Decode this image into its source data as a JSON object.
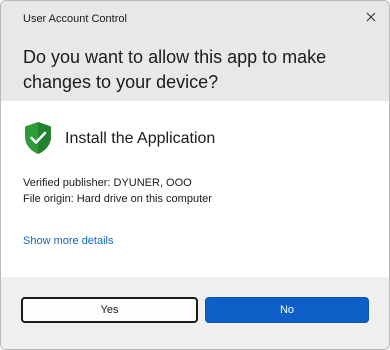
{
  "window": {
    "title": "User Account Control"
  },
  "header": {
    "question": "Do you want to allow this app to make changes to your device?"
  },
  "app": {
    "name": "Install the Application",
    "publisher": "Verified publisher: DYUNER, OOO",
    "origin": "File origin: Hard drive on this computer",
    "details_link": "Show more details"
  },
  "buttons": {
    "yes": "Yes",
    "no": "No"
  },
  "colors": {
    "header_bg": "#e8e8e8",
    "footer_bg": "#efefef",
    "shield_green": "#2e9b3a",
    "link_blue": "#1266c2",
    "primary_button": "#0d5fc7"
  },
  "icons": {
    "close": "close-icon",
    "shield": "shield-check-icon"
  }
}
